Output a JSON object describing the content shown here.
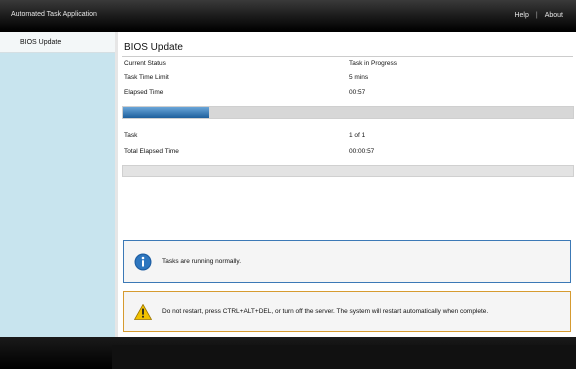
{
  "app": {
    "title": "Automated Task Application"
  },
  "header": {
    "links": [
      {
        "label": "Help"
      },
      {
        "label": "About"
      }
    ]
  },
  "sidebar": {
    "items": [
      {
        "label": "BIOS Update"
      }
    ]
  },
  "main": {
    "title": "BIOS Update",
    "status_rows": [
      {
        "label": "Current Status",
        "value": "Task in Progress"
      },
      {
        "label": "Task Time Limit",
        "value": "5 mins"
      },
      {
        "label": "Elapsed Time",
        "value": "00:57"
      }
    ],
    "progress": {
      "fraction": 0.19,
      "accent": "#1d5f9c"
    },
    "task_rows": [
      {
        "label": "Task",
        "value": "1 of 1"
      },
      {
        "label": "Total Elapsed Time",
        "value": "00:00:57"
      }
    ],
    "messages": {
      "info": {
        "text": "Tasks are running normally.",
        "icon": "info-icon",
        "color": "#3c79b6"
      },
      "warning": {
        "text": "Do not restart, press CTRL+ALT+DEL, or turn off the server.  The system will restart automatically when complete.",
        "icon": "warning-icon",
        "color": "#d69b30"
      }
    }
  }
}
